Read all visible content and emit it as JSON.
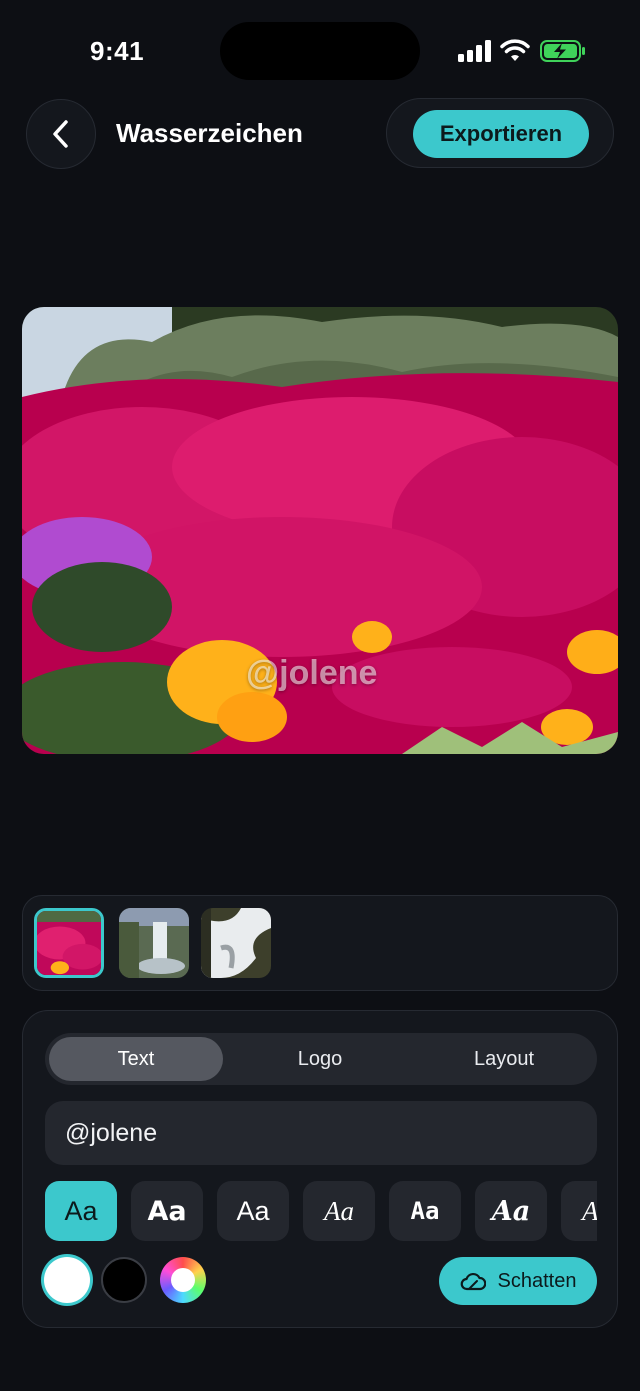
{
  "status": {
    "time": "9:41"
  },
  "header": {
    "title": "Wasserzeichen",
    "export_label": "Exportieren"
  },
  "preview": {
    "watermark_text": "@jolene"
  },
  "thumbnails": [
    {
      "name": "thumb-flowers",
      "selected": true
    },
    {
      "name": "thumb-waterfall",
      "selected": false
    },
    {
      "name": "thumb-river",
      "selected": false
    }
  ],
  "tabs": [
    {
      "label": "Text",
      "active": true
    },
    {
      "label": "Logo",
      "active": false
    },
    {
      "label": "Layout",
      "active": false
    }
  ],
  "text_field": {
    "value": "@jolene"
  },
  "fonts": [
    {
      "label": "Aa",
      "active": true
    },
    {
      "label": "Aa",
      "active": false
    },
    {
      "label": "Aa",
      "active": false
    },
    {
      "label": "Aa",
      "active": false
    },
    {
      "label": "Aa",
      "active": false
    },
    {
      "label": "Aa",
      "active": false
    },
    {
      "label": "Aa",
      "active": false
    }
  ],
  "colors": {
    "accent": "#3cc8cc",
    "swatches": [
      "#ffffff",
      "#000000",
      "picker"
    ]
  },
  "shadow_button": {
    "label": "Schatten",
    "icon": "cloud-icon"
  }
}
